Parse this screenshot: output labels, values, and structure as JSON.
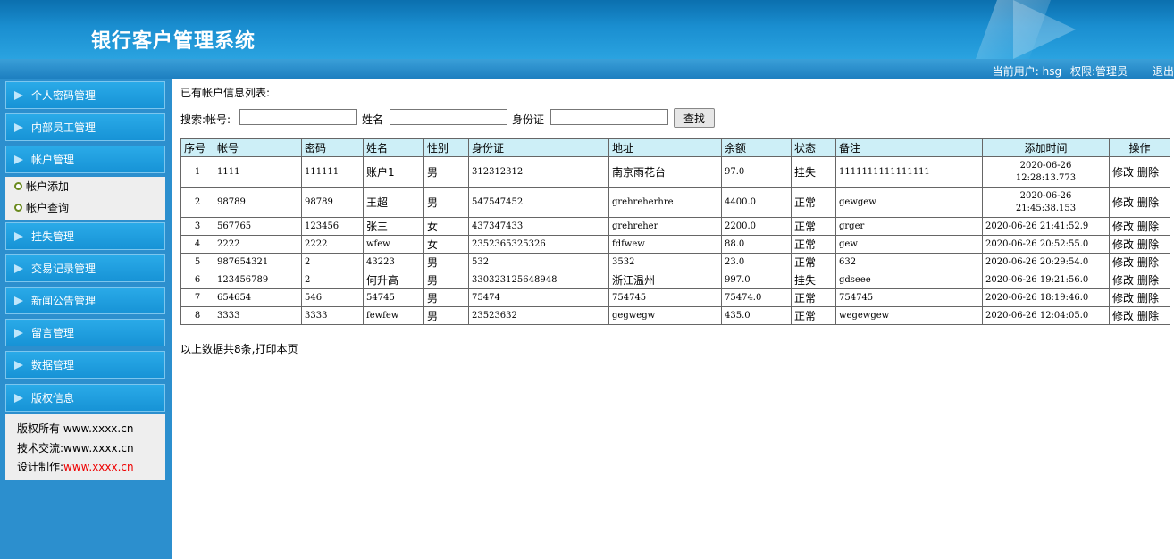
{
  "header": {
    "title": "银行客户管理系统"
  },
  "status": {
    "user_label": "当前用户:",
    "user": "hsg",
    "role_label": "权限:",
    "role": "管理员",
    "logout": "退出"
  },
  "sidebar": {
    "items": [
      {
        "label": "个人密码管理"
      },
      {
        "label": "内部员工管理"
      },
      {
        "label": "帐户管理"
      },
      {
        "label": "挂失管理"
      },
      {
        "label": "交易记录管理"
      },
      {
        "label": "新闻公告管理"
      },
      {
        "label": "留言管理"
      },
      {
        "label": "数据管理"
      },
      {
        "label": "版权信息"
      }
    ],
    "submenu": [
      "帐户添加",
      "帐户查询"
    ],
    "copyright": [
      {
        "label": "版权所有",
        "value": "www.xxxx.cn"
      },
      {
        "label": "技术交流:",
        "value": "www.xxxx.cn"
      },
      {
        "label": "设计制作:",
        "value": "www.xxxx.cn"
      }
    ]
  },
  "main": {
    "caption": "已有帐户信息列表:",
    "search": {
      "label_account": "搜索:帐号:",
      "label_name": "姓名",
      "label_id": "身份证",
      "button": "查找",
      "account": "",
      "name": "",
      "id": ""
    },
    "columns": [
      "序号",
      "帐号",
      "密码",
      "姓名",
      "性别",
      "身份证",
      "地址",
      "余额",
      "状态",
      "备注",
      "添加时间",
      "操作"
    ],
    "rows": [
      {
        "no": "1",
        "account": "1111",
        "password": "111111",
        "name": "账户1",
        "gender": "男",
        "id_card": "312312312",
        "address": "南京雨花台",
        "balance": "97.0",
        "state": "挂失",
        "note": "1111111111111111",
        "time_date": "2020-06-26",
        "time_clock": "12:28:13.773"
      },
      {
        "no": "2",
        "account": "98789",
        "password": "98789",
        "name": "王超",
        "gender": "男",
        "id_card": "547547452",
        "address": "grehreherhre",
        "balance": "4400.0",
        "state": "正常",
        "note": "gewgew",
        "time_date": "2020-06-26",
        "time_clock": "21:45:38.153"
      },
      {
        "no": "3",
        "account": "567765",
        "password": "123456",
        "name": "张三",
        "gender": "女",
        "id_card": "437347433",
        "address": "grehreher",
        "balance": "2200.0",
        "state": "正常",
        "note": "grger",
        "time": "2020-06-26 21:41:52.9"
      },
      {
        "no": "4",
        "account": "2222",
        "password": "2222",
        "name": "wfew",
        "gender": "女",
        "id_card": "2352365325326",
        "address": "fdfwew",
        "balance": "88.0",
        "state": "正常",
        "note": "gew",
        "time": "2020-06-26 20:52:55.0"
      },
      {
        "no": "5",
        "account": "987654321",
        "password": "2",
        "name": "43223",
        "gender": "男",
        "id_card": "532",
        "address": "3532",
        "balance": "23.0",
        "state": "正常",
        "note": "632",
        "time": "2020-06-26 20:29:54.0"
      },
      {
        "no": "6",
        "account": "123456789",
        "password": "2",
        "name": "何升高",
        "gender": "男",
        "id_card": "330323125648948",
        "address": "浙江温州",
        "balance": "997.0",
        "state": "挂失",
        "note": "gdseee",
        "time": "2020-06-26 19:21:56.0"
      },
      {
        "no": "7",
        "account": "654654",
        "password": "546",
        "name": "54745",
        "gender": "男",
        "id_card": "75474",
        "address": "754745",
        "balance": "75474.0",
        "state": "正常",
        "note": "754745",
        "time": "2020-06-26 18:19:46.0"
      },
      {
        "no": "8",
        "account": "3333",
        "password": "3333",
        "name": "fewfew",
        "gender": "男",
        "id_card": "23523632",
        "address": "gegwegw",
        "balance": "435.0",
        "state": "正常",
        "note": "wegewgew",
        "time": "2020-06-26 12:04:05.0"
      }
    ],
    "actions": {
      "edit": "修改",
      "delete": "删除"
    },
    "footer": "以上数据共8条,打印本页"
  }
}
